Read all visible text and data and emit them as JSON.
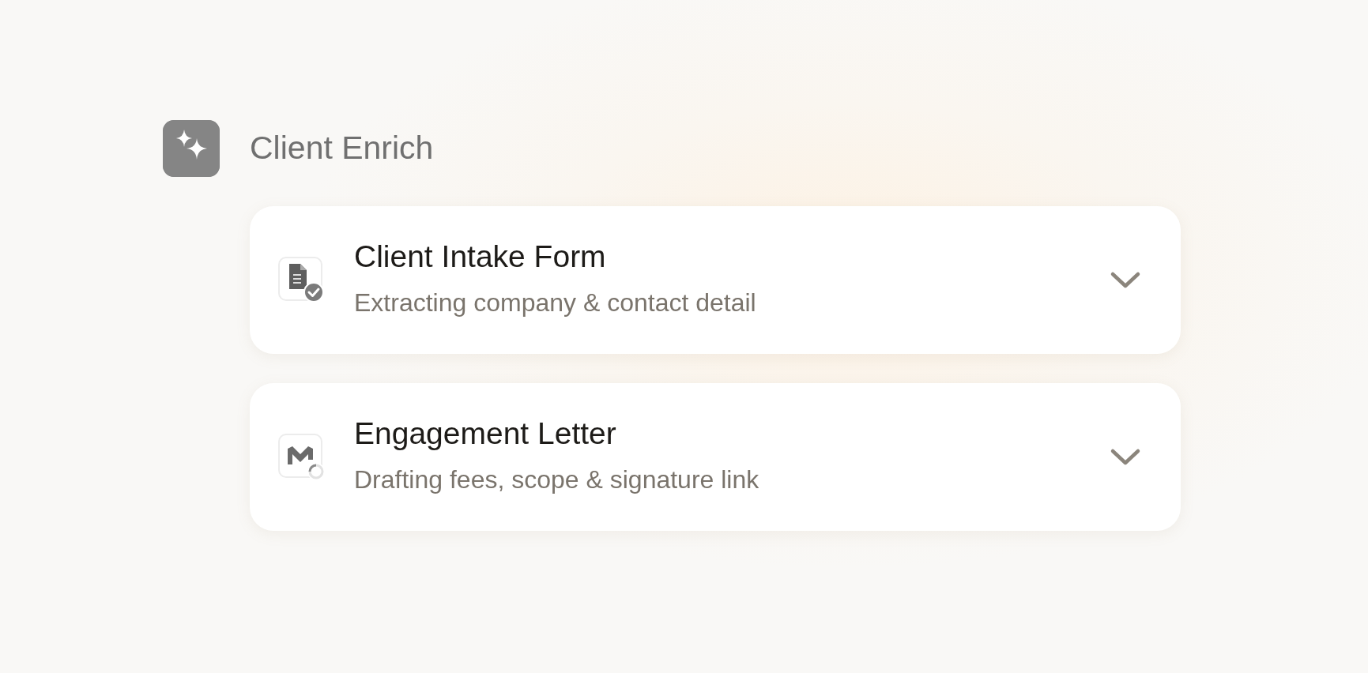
{
  "header": {
    "title": "Client Enrich"
  },
  "tasks": [
    {
      "title": "Client Intake Form",
      "subtitle": "Extracting company & contact detail",
      "kind": "form",
      "done": true,
      "expanded": false
    },
    {
      "title": "Engagement Letter",
      "subtitle": "Drafting fees, scope & signature link",
      "kind": "mail",
      "done": false,
      "expanded": false
    }
  ]
}
